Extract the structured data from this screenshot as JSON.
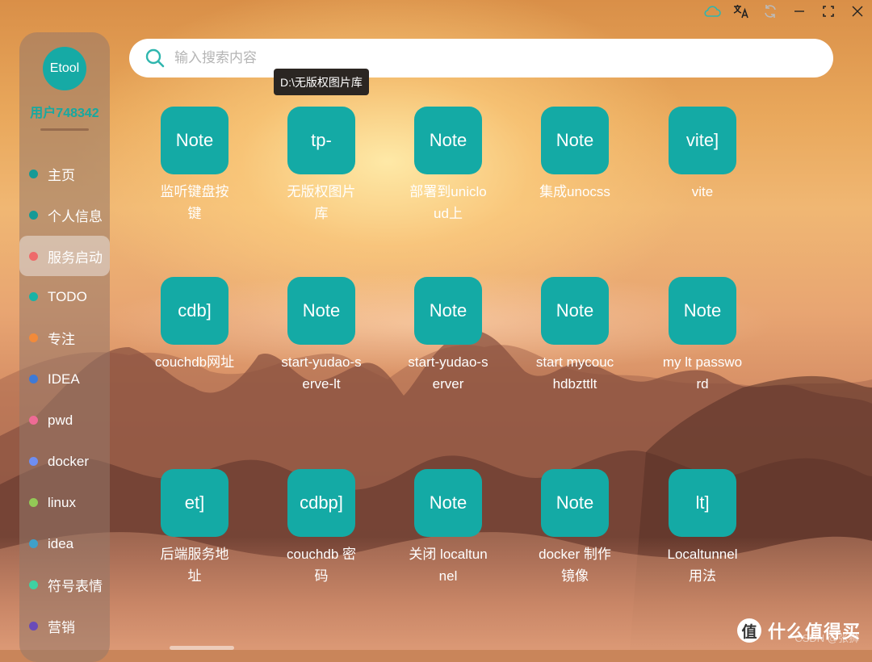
{
  "window": {
    "controls": [
      "cloud-icon",
      "translate-icon",
      "refresh-icon",
      "minimize-icon",
      "maximize-icon",
      "close-icon"
    ]
  },
  "sidebar": {
    "avatar_text": "Etool",
    "username": "用户748342",
    "items": [
      {
        "label": "主页",
        "color": "#159a96",
        "active": false
      },
      {
        "label": "个人信息",
        "color": "#159a96",
        "active": false
      },
      {
        "label": "服务启动",
        "color": "#ee6b6b",
        "active": true
      },
      {
        "label": "TODO",
        "color": "#17b3a6",
        "active": false
      },
      {
        "label": "专注",
        "color": "#f28a3a",
        "active": false
      },
      {
        "label": "IDEA",
        "color": "#3f7ad6",
        "active": false
      },
      {
        "label": "pwd",
        "color": "#ee6b95",
        "active": false
      },
      {
        "label": "docker",
        "color": "#6e8ef2",
        "active": false
      },
      {
        "label": "linux",
        "color": "#93c956",
        "active": false
      },
      {
        "label": "idea",
        "color": "#3fa0c9",
        "active": false
      },
      {
        "label": "符号表情",
        "color": "#3fd1a2",
        "active": false
      },
      {
        "label": "营销",
        "color": "#6a4bb8",
        "active": false
      }
    ]
  },
  "search": {
    "placeholder": "输入搜索内容",
    "value": ""
  },
  "tooltip": "D:\\无版权图片库",
  "tiles": [
    {
      "icon_text": "Note",
      "label": "监听键盘按键"
    },
    {
      "icon_text": "tp-",
      "label": "无版权图片库"
    },
    {
      "icon_text": "Note",
      "label": "部署到unicloud上"
    },
    {
      "icon_text": "Note",
      "label": "集成unocss"
    },
    {
      "icon_text": "vite]",
      "label": "vite"
    },
    {
      "icon_text": "cdb]",
      "label": "couchdb网址"
    },
    {
      "icon_text": "Note",
      "label": "start-yudao-serve-lt"
    },
    {
      "icon_text": "Note",
      "label": "start-yudao-server"
    },
    {
      "icon_text": "Note",
      "label": "start mycouchdbzttlt"
    },
    {
      "icon_text": "Note",
      "label": "my lt password"
    },
    {
      "icon_text": "et]",
      "label": "后端服务地址"
    },
    {
      "icon_text": "cdbp]",
      "label": "couchdb 密码"
    },
    {
      "icon_text": "Note",
      "label": "关闭 localtunnel"
    },
    {
      "icon_text": "Note",
      "label": "docker 制作镜像"
    },
    {
      "icon_text": "lt]",
      "label": "Localtunnel 用法"
    }
  ],
  "watermark": {
    "badge": "值",
    "text": "什么值得买",
    "csdn": "CSDN @张狮"
  },
  "colors": {
    "accent": "#14aaa5",
    "tooltip_bg": "#2b2622"
  }
}
